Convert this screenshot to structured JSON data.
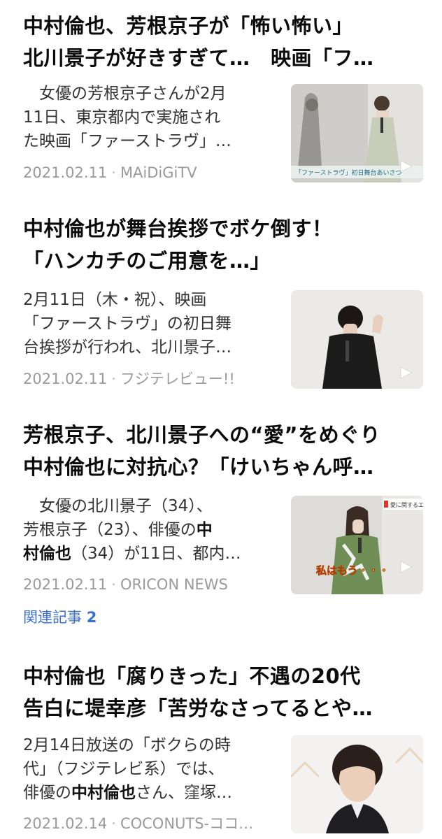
{
  "articles": [
    {
      "title_lines": [
        "中村倫也、芳根京子が「怖い怖い」",
        "北川景子が好きすぎて…　映画「フ…"
      ],
      "summary_lines": [
        "　女優の芳根京子さんが2月",
        "11日、東京都内で実施され",
        "た映画「ファーストラヴ」…"
      ],
      "date": "2021.02.11",
      "source": "MAiDiGiTV",
      "thumb_caption": "「ファーストラヴ」初日舞台あいさつ"
    },
    {
      "title_lines": [
        "中村倫也が舞台挨拶でボケ倒す！",
        "「ハンカチのご用意を…」"
      ],
      "summary_lines": [
        "2月11日（木・祝）、映画",
        "「ファーストラヴ」の初日舞",
        "台挨拶が行われ、北川景子…"
      ],
      "date": "2021.02.11",
      "source": "フジテレビュー!!"
    },
    {
      "title_lines": [
        "芳根京子、北川景子への“愛”をめぐり",
        "中村倫也に対抗心？「けいちゃん呼…"
      ],
      "summary_parts": [
        [
          "　女優の北川景子（34）、"
        ],
        [
          "芳根京子（23）、俳優の",
          "中"
        ],
        [
          "村倫也",
          "（34）が11日、都内…"
        ]
      ],
      "date": "2021.02.11",
      "source": "ORICON NEWS",
      "thumb_caption": "私はもう・・・",
      "thumb_badge": "愛に関するエ",
      "related_label": "関連記事",
      "related_count": "2"
    },
    {
      "title_lines": [
        "中村倫也「腐りきった」不遇の20代",
        "告白に堤幸彦「苦労なさってるとや…"
      ],
      "summary_parts": [
        [
          "2月14日放送の「ボクらの時"
        ],
        [
          "代」（フジテレビ系）では、"
        ],
        [
          "俳優の",
          "中村倫也",
          "さん、窪塚…"
        ]
      ],
      "date": "2021.02.14",
      "source": "COCONUTS-ココ…"
    }
  ],
  "separator": "·",
  "icons": {
    "play": "play-icon"
  }
}
